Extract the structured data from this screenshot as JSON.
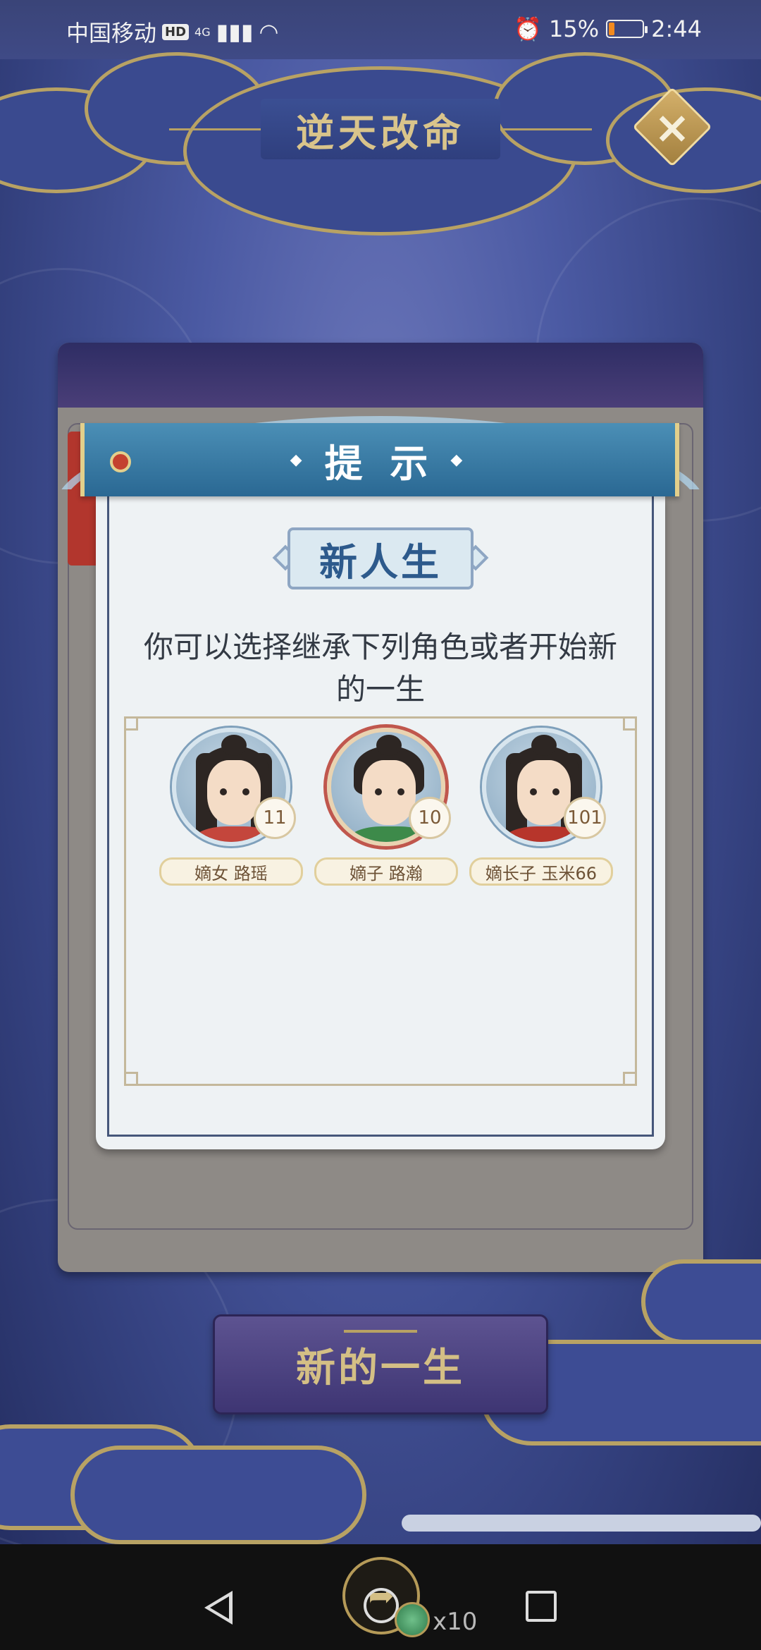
{
  "status_bar": {
    "carrier": "中国移动",
    "hd_badge": "HD",
    "network": "4G",
    "battery_percent": "15%",
    "battery_level": 0.15,
    "time": "2:44"
  },
  "screen_title": "逆天改命",
  "dialog": {
    "header": "提 示",
    "subtitle": "新人生",
    "message": "你可以选择继承下列角色或者开始新的一生",
    "characters": [
      {
        "level": "11",
        "name": "嫡女 路瑶"
      },
      {
        "level": "10",
        "name": "嫡子 路瀚"
      },
      {
        "level": "101",
        "name": "嫡长子 玉米66"
      }
    ]
  },
  "action_button": "新的一生",
  "bottom_widget": {
    "share_icon": "share-arrow-icon",
    "coin_count": "x10"
  },
  "colors": {
    "background": "#4b5aa3",
    "gold": "#b8a264",
    "dialog_header": "#2a6893",
    "dialog_body": "#eef2f4"
  }
}
